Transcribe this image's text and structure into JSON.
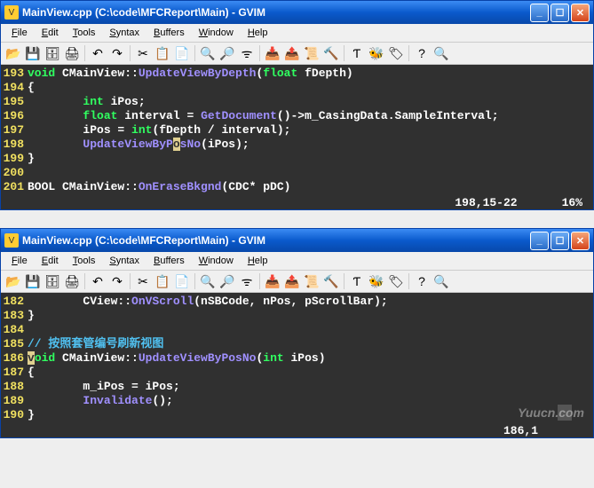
{
  "windows": [
    {
      "title": "MainView.cpp (C:\\code\\MFCReport\\Main) - GVIM",
      "menus": [
        "File",
        "Edit",
        "Tools",
        "Syntax",
        "Buffers",
        "Window",
        "Help"
      ],
      "lines": [
        {
          "num": "193",
          "tokens": [
            {
              "t": "kw",
              "s": "void"
            },
            {
              "t": "ident",
              "s": " CMainView::"
            },
            {
              "t": "func",
              "s": "UpdateViewByDepth"
            },
            {
              "t": "ident",
              "s": "("
            },
            {
              "t": "kw",
              "s": "float"
            },
            {
              "t": "ident",
              "s": " fDepth)"
            }
          ]
        },
        {
          "num": "194",
          "tokens": [
            {
              "t": "ident",
              "s": "{"
            }
          ]
        },
        {
          "num": "195",
          "tokens": [
            {
              "t": "ident",
              "s": "        "
            },
            {
              "t": "kw",
              "s": "int"
            },
            {
              "t": "ident",
              "s": " iPos;"
            }
          ]
        },
        {
          "num": "196",
          "tokens": [
            {
              "t": "ident",
              "s": "        "
            },
            {
              "t": "kw",
              "s": "float"
            },
            {
              "t": "ident",
              "s": " interval = "
            },
            {
              "t": "func",
              "s": "GetDocument"
            },
            {
              "t": "ident",
              "s": "()->m_CasingData.SampleInterval;"
            }
          ]
        },
        {
          "num": "197",
          "tokens": [
            {
              "t": "ident",
              "s": "        iPos = "
            },
            {
              "t": "kw",
              "s": "int"
            },
            {
              "t": "ident",
              "s": "(fDepth / interval);"
            }
          ]
        },
        {
          "num": "198",
          "tokens": [
            {
              "t": "ident",
              "s": "        "
            },
            {
              "t": "func",
              "s": "UpdateViewByP"
            },
            {
              "t": "cursor",
              "s": "o"
            },
            {
              "t": "func",
              "s": "sNo"
            },
            {
              "t": "ident",
              "s": "(iPos);"
            }
          ]
        },
        {
          "num": "199",
          "tokens": [
            {
              "t": "ident",
              "s": "}"
            }
          ]
        },
        {
          "num": "200",
          "tokens": []
        },
        {
          "num": "201",
          "tokens": [
            {
              "t": "ident",
              "s": "BOOL CMainView::"
            },
            {
              "t": "func",
              "s": "OnEraseBkgnd"
            },
            {
              "t": "ident",
              "s": "(CDC* pDC)"
            }
          ]
        }
      ],
      "status_pos": "198,15-22",
      "status_pct": "16%"
    },
    {
      "title": "MainView.cpp (C:\\code\\MFCReport\\Main) - GVIM",
      "menus": [
        "File",
        "Edit",
        "Tools",
        "Syntax",
        "Buffers",
        "Window",
        "Help"
      ],
      "lines": [
        {
          "num": "182",
          "tokens": [
            {
              "t": "ident",
              "s": "        CView::"
            },
            {
              "t": "func",
              "s": "OnVScroll"
            },
            {
              "t": "ident",
              "s": "(nSBCode, nPos, pScrollBar);"
            }
          ]
        },
        {
          "num": "183",
          "tokens": [
            {
              "t": "ident",
              "s": "}"
            }
          ]
        },
        {
          "num": "184",
          "tokens": []
        },
        {
          "num": "185",
          "tokens": [
            {
              "t": "comment",
              "s": "// 按照套管编号刷新视图"
            }
          ]
        },
        {
          "num": "186",
          "tokens": [
            {
              "t": "cursor",
              "s": "v"
            },
            {
              "t": "kw",
              "s": "oid"
            },
            {
              "t": "ident",
              "s": " CMainView::"
            },
            {
              "t": "func",
              "s": "UpdateViewByPosNo"
            },
            {
              "t": "ident",
              "s": "("
            },
            {
              "t": "kw",
              "s": "int"
            },
            {
              "t": "ident",
              "s": " iPos)"
            }
          ]
        },
        {
          "num": "187",
          "tokens": [
            {
              "t": "ident",
              "s": "{"
            }
          ]
        },
        {
          "num": "188",
          "tokens": [
            {
              "t": "ident",
              "s": "        m_iPos = iPos;"
            }
          ]
        },
        {
          "num": "189",
          "tokens": [
            {
              "t": "ident",
              "s": "        "
            },
            {
              "t": "func",
              "s": "Invalidate"
            },
            {
              "t": "ident",
              "s": "();"
            }
          ]
        },
        {
          "num": "190",
          "tokens": [
            {
              "t": "ident",
              "s": "}"
            }
          ]
        }
      ],
      "status_pos": "186,1",
      "status_pct": "",
      "watermark": "Yuucn.com"
    }
  ],
  "toolbar_icons": [
    {
      "name": "open-file-icon",
      "glyph": "📂"
    },
    {
      "name": "save-icon",
      "glyph": "💾"
    },
    {
      "name": "save-all-icon",
      "glyph": "🗄"
    },
    {
      "name": "print-icon",
      "glyph": "🖨"
    },
    {
      "sep": true
    },
    {
      "name": "undo-icon",
      "glyph": "↶"
    },
    {
      "name": "redo-icon",
      "glyph": "↷"
    },
    {
      "sep": true
    },
    {
      "name": "cut-icon",
      "glyph": "✂"
    },
    {
      "name": "copy-icon",
      "glyph": "📋"
    },
    {
      "name": "paste-icon",
      "glyph": "📄"
    },
    {
      "sep": true
    },
    {
      "name": "find-icon",
      "glyph": "🔍"
    },
    {
      "name": "find-next-icon",
      "glyph": "🔎"
    },
    {
      "name": "replace-icon",
      "glyph": "ᯤ"
    },
    {
      "sep": true
    },
    {
      "name": "load-session-icon",
      "glyph": "📥"
    },
    {
      "name": "save-session-icon",
      "glyph": "📤"
    },
    {
      "name": "run-script-icon",
      "glyph": "📜"
    },
    {
      "name": "make-icon",
      "glyph": "🔨"
    },
    {
      "sep": true
    },
    {
      "name": "shell-icon",
      "glyph": "Ƭ"
    },
    {
      "name": "ctags-icon",
      "glyph": "🐝"
    },
    {
      "name": "tag-jump-icon",
      "glyph": "🏷"
    },
    {
      "sep": true
    },
    {
      "name": "help-icon",
      "glyph": "?"
    },
    {
      "name": "find-help-icon",
      "glyph": "🔍"
    }
  ]
}
